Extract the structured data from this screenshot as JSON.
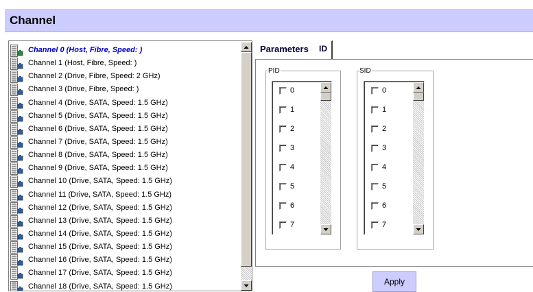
{
  "page": {
    "title": "Channel"
  },
  "channel_list": {
    "selected_index": 0,
    "items": [
      {
        "label": "Channel 0 (Host, Fibre, Speed: )"
      },
      {
        "label": "Channel 1 (Host, Fibre, Speed: )"
      },
      {
        "label": "Channel 2 (Drive, Fibre, Speed: 2 GHz)"
      },
      {
        "label": "Channel 3 (Drive, Fibre, Speed: )"
      },
      {
        "label": "Channel 4 (Drive, SATA, Speed: 1.5 GHz)"
      },
      {
        "label": "Channel 5 (Drive, SATA, Speed: 1.5 GHz)"
      },
      {
        "label": "Channel 6 (Drive, SATA, Speed: 1.5 GHz)"
      },
      {
        "label": "Channel 7 (Drive, SATA, Speed: 1.5 GHz)"
      },
      {
        "label": "Channel 8 (Drive, SATA, Speed: 1.5 GHz)"
      },
      {
        "label": "Channel 9 (Drive, SATA, Speed: 1.5 GHz)"
      },
      {
        "label": "Channel 10 (Drive, SATA, Speed: 1.5 GHz)"
      },
      {
        "label": "Channel 11 (Drive, SATA, Speed: 1.5 GHz)"
      },
      {
        "label": "Channel 12 (Drive, SATA, Speed: 1.5 GHz)"
      },
      {
        "label": "Channel 13 (Drive, SATA, Speed: 1.5 GHz)"
      },
      {
        "label": "Channel 14 (Drive, SATA, Speed: 1.5 GHz)"
      },
      {
        "label": "Channel 15 (Drive, SATA, Speed: 1.5 GHz)"
      },
      {
        "label": "Channel 16 (Drive, SATA, Speed: 1.5 GHz)"
      },
      {
        "label": "Channel 17 (Drive, SATA, Speed: 1.5 GHz)"
      },
      {
        "label": "Channel 18 (Drive, SATA, Speed: 1.5 GHz)"
      }
    ]
  },
  "tabs": [
    {
      "label": "Parameters",
      "active": false
    },
    {
      "label": "ID",
      "active": true
    }
  ],
  "pid": {
    "legend": "PID",
    "items": [
      {
        "label": "0",
        "checked": false
      },
      {
        "label": "1",
        "checked": false
      },
      {
        "label": "2",
        "checked": false
      },
      {
        "label": "3",
        "checked": false
      },
      {
        "label": "4",
        "checked": false
      },
      {
        "label": "5",
        "checked": false
      },
      {
        "label": "6",
        "checked": false
      },
      {
        "label": "7",
        "checked": false
      }
    ]
  },
  "sid": {
    "legend": "SID",
    "items": [
      {
        "label": "0",
        "checked": false
      },
      {
        "label": "1",
        "checked": false
      },
      {
        "label": "2",
        "checked": false
      },
      {
        "label": "3",
        "checked": false
      },
      {
        "label": "4",
        "checked": false
      },
      {
        "label": "5",
        "checked": false
      },
      {
        "label": "6",
        "checked": false
      },
      {
        "label": "7",
        "checked": false
      }
    ]
  },
  "apply_label": "Apply",
  "colors": {
    "title_bar": "#ccccff",
    "selected_text": "#0000cc",
    "apply_button": "#ccccff",
    "host_icon": "#2e8b3a",
    "drive_icon": "#2a5ea8"
  },
  "icons": {
    "host_channel": "channel-host-icon",
    "drive_channel": "channel-drive-icon"
  }
}
